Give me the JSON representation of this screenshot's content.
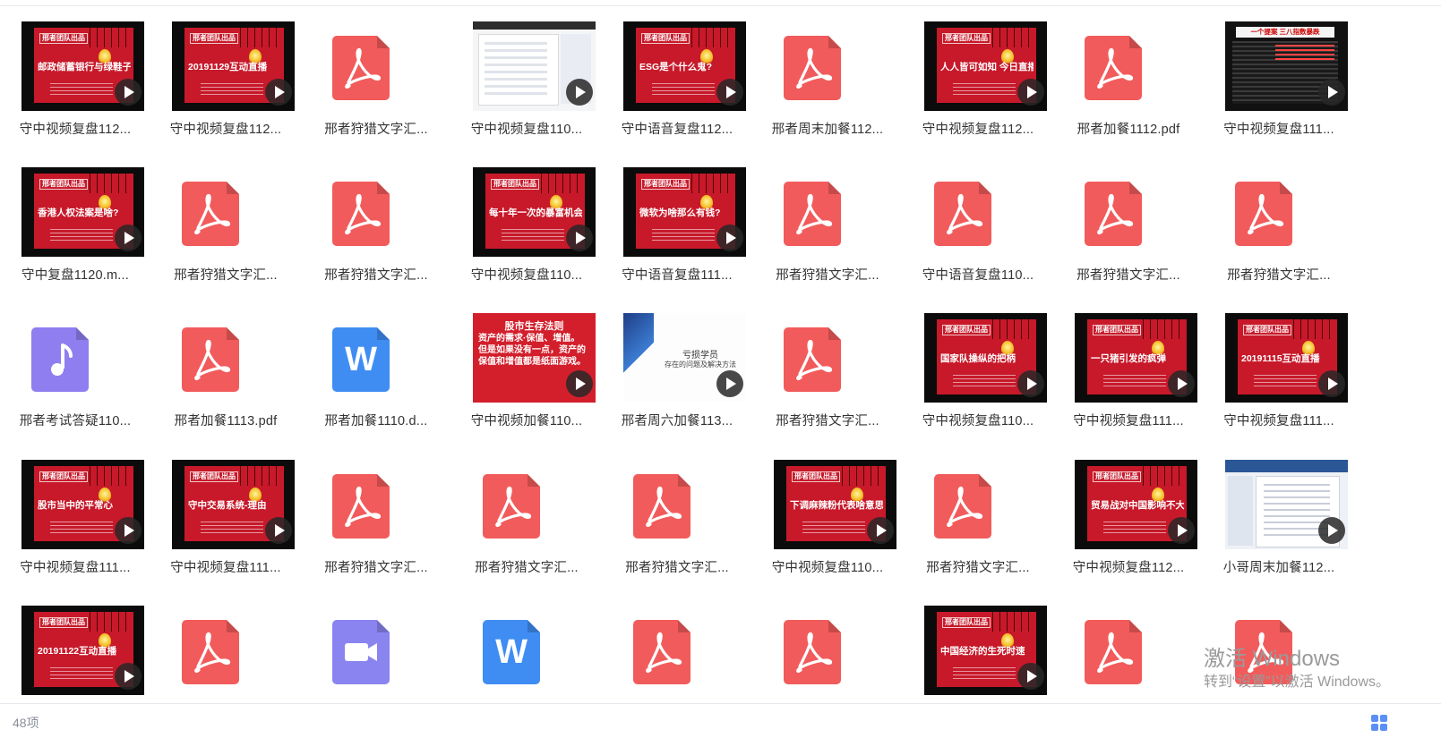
{
  "footer": {
    "item_count": "48项",
    "view_toggle_icon": "grid-view-icon"
  },
  "watermark": {
    "line1": "激活 Windows",
    "line2": "转到“设置”以激活 Windows。"
  },
  "files": [
    {
      "name": "守中视频复盘112...",
      "kind": "video",
      "headline": "邮政储蓄银行与绿鞋子"
    },
    {
      "name": "守中视频复盘112...",
      "kind": "video",
      "headline": "20191129互动直播"
    },
    {
      "name": "邢者狩猎文字汇...",
      "kind": "pdf"
    },
    {
      "name": "守中视频复盘110...",
      "kind": "screen"
    },
    {
      "name": "守中语音复盘112...",
      "kind": "video",
      "headline": "ESG是个什么鬼?"
    },
    {
      "name": "邢者周末加餐112...",
      "kind": "pdf"
    },
    {
      "name": "守中视频复盘112...",
      "kind": "video",
      "headline": "人人皆可如知 今日直播技术详解"
    },
    {
      "name": "邢者加餐1112.pdf",
      "kind": "pdf"
    },
    {
      "name": "守中视频复盘111...",
      "kind": "news",
      "headline": "一个提案 三八指数暴跌"
    },
    {
      "name": "守中复盘1120.m...",
      "kind": "video",
      "headline": "香港人权法案是啥?"
    },
    {
      "name": "邢者狩猎文字汇...",
      "kind": "pdf"
    },
    {
      "name": "邢者狩猎文字汇...",
      "kind": "pdf"
    },
    {
      "name": "守中视频复盘110...",
      "kind": "video",
      "headline": "每十年一次的暴富机会"
    },
    {
      "name": "守中语音复盘111...",
      "kind": "video",
      "headline": "微软为啥那么有钱?"
    },
    {
      "name": "邢者狩猎文字汇...",
      "kind": "pdf"
    },
    {
      "name": "守中语音复盘110...",
      "kind": "pdf"
    },
    {
      "name": "邢者狩猎文字汇...",
      "kind": "pdf"
    },
    {
      "name": "邢者狩猎文字汇...",
      "kind": "pdf"
    },
    {
      "name": "邢者考试答疑110...",
      "kind": "music"
    },
    {
      "name": "邢者加餐1113.pdf",
      "kind": "pdf"
    },
    {
      "name": "邢者加餐1110.d...",
      "kind": "word"
    },
    {
      "name": "守中视频加餐110...",
      "kind": "redtext",
      "headline": "股市生存法则",
      "sub": "资产的需求·保值、增值。但是如果没有一点，资产的保值和增值都是纸面游戏。"
    },
    {
      "name": "邢者周六加餐113...",
      "kind": "blueslide",
      "headline": "亏损学员",
      "sub": "存在的问题及解决方法"
    },
    {
      "name": "邢者狩猎文字汇...",
      "kind": "pdf"
    },
    {
      "name": "守中视频复盘110...",
      "kind": "video",
      "headline": "国家队操纵的把柄"
    },
    {
      "name": "守中视频复盘111...",
      "kind": "video",
      "headline": "一只猪引发的疯弹"
    },
    {
      "name": "守中视频复盘111...",
      "kind": "video",
      "headline": "20191115互动直播"
    },
    {
      "name": "守中视频复盘111...",
      "kind": "video",
      "headline": "股市当中的平常心"
    },
    {
      "name": "守中视频复盘111...",
      "kind": "video",
      "headline": "守中交易系统-理由"
    },
    {
      "name": "邢者狩猎文字汇...",
      "kind": "pdf"
    },
    {
      "name": "邢者狩猎文字汇...",
      "kind": "pdf"
    },
    {
      "name": "邢者狩猎文字汇...",
      "kind": "pdf"
    },
    {
      "name": "守中视频复盘110...",
      "kind": "video",
      "headline": "下调麻辣粉代表啥意思?"
    },
    {
      "name": "邢者狩猎文字汇...",
      "kind": "pdf"
    },
    {
      "name": "守中视频复盘112...",
      "kind": "video",
      "headline": "贸易战对中国影响不大"
    },
    {
      "name": "小哥周末加餐112...",
      "kind": "docshot"
    },
    {
      "name": "",
      "kind": "video",
      "headline": "20191122互动直播"
    },
    {
      "name": "",
      "kind": "pdf"
    },
    {
      "name": "",
      "kind": "videofile"
    },
    {
      "name": "",
      "kind": "word"
    },
    {
      "name": "",
      "kind": "pdf"
    },
    {
      "name": "",
      "kind": "pdf"
    },
    {
      "name": "",
      "kind": "video",
      "headline": "中国经济的生死时速"
    },
    {
      "name": "",
      "kind": "pdf"
    },
    {
      "name": "",
      "kind": "pdf"
    }
  ],
  "brand_label": "邢者团队出品",
  "colors": {
    "pdf": "#f25b5b",
    "word": "#3f8df3",
    "music": "#8f7ef0",
    "videofile": "#8a84f0",
    "poster": "#c7192a",
    "accent": "#5b8ff5"
  }
}
